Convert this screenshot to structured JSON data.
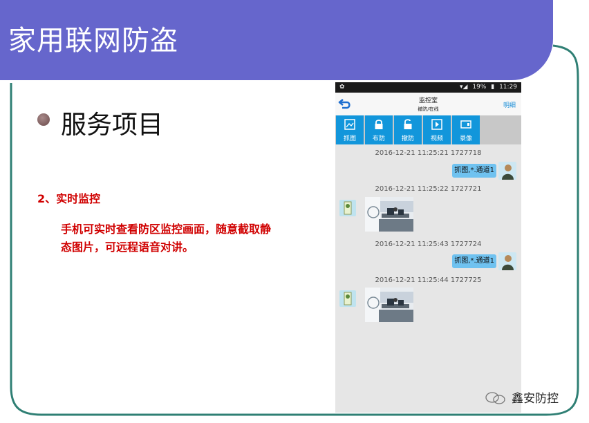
{
  "slide": {
    "title": "家用联网防盗",
    "bullet": "服务项目",
    "section_heading": "2、实时监控",
    "section_body": "手机可实时查看防区监控画面，随意截取静态图片，可远程语音对讲。"
  },
  "phone": {
    "status": {
      "battery": "19%",
      "time": "11:29"
    },
    "nav": {
      "title": "监控室",
      "subtitle": "撤防/在线",
      "detail": "明细"
    },
    "toolbar": [
      {
        "label": "抓图",
        "icon": "camera-capture-icon"
      },
      {
        "label": "布防",
        "icon": "lock-icon"
      },
      {
        "label": "撤防",
        "icon": "unlock-icon"
      },
      {
        "label": "视频",
        "icon": "play-icon"
      },
      {
        "label": "录像",
        "icon": "video-record-icon"
      }
    ],
    "messages": [
      {
        "timestamp": "2016-12-21 11:25:21 1727718",
        "text": "抓图,*.通道1"
      },
      {
        "timestamp": "2016-12-21 11:25:22 1727721",
        "image": "camera-snapshot"
      },
      {
        "timestamp": "2016-12-21 11:25:43 1727724",
        "text": "抓图,*.通道1"
      },
      {
        "timestamp": "2016-12-21 11:25:44 1727725",
        "image": "camera-snapshot"
      }
    ]
  },
  "watermark": "鑫安防控",
  "colors": {
    "title_bar": "#6666cc",
    "accent_red": "#d00000",
    "tool_blue": "#1296db",
    "frame_teal": "#2f7f74"
  }
}
